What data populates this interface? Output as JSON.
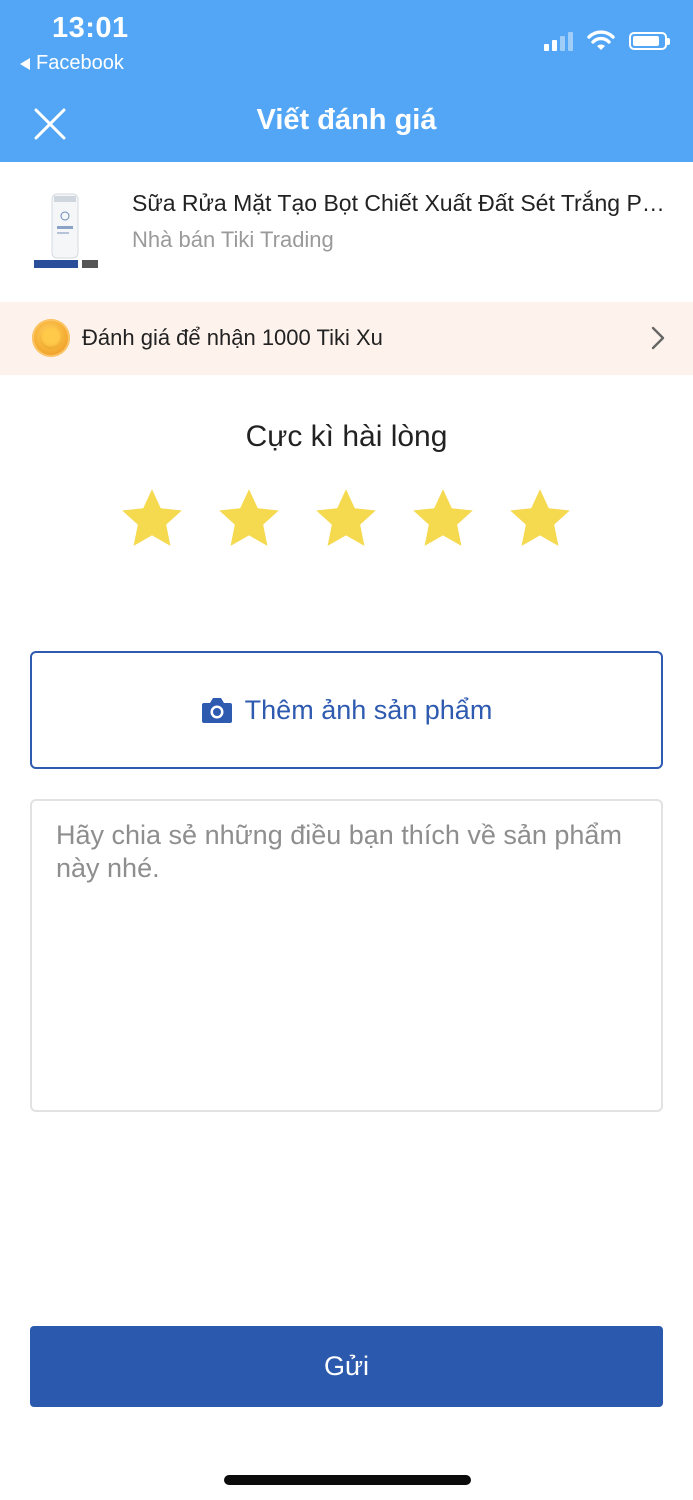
{
  "status_bar": {
    "time": "13:01",
    "back_app": "Facebook"
  },
  "header": {
    "title": "Viết đánh giá",
    "close_icon": "close-icon"
  },
  "product": {
    "name": "Sữa Rửa Mặt Tạo Bọt Chiết Xuất Đất Sét Trắng Perfect Whip Clay",
    "seller": "Nhà bán Tiki Trading"
  },
  "reward": {
    "text": "Đánh giá để nhận 1000 Tiki Xu",
    "icon": "coin-icon"
  },
  "rating": {
    "label": "Cực kì hài lòng",
    "value": 5,
    "max": 5,
    "star_color": "#f5d94f"
  },
  "add_photo": {
    "label": "Thêm ảnh sản phẩm",
    "icon": "camera-icon"
  },
  "review": {
    "value": "",
    "placeholder": "Hãy chia sẻ những điều bạn thích về sản phẩm này nhé."
  },
  "submit": {
    "label": "Gửi"
  },
  "colors": {
    "header_bg": "#53a6f5",
    "primary": "#2a59ae",
    "reward_bg": "#fdf3ec"
  }
}
